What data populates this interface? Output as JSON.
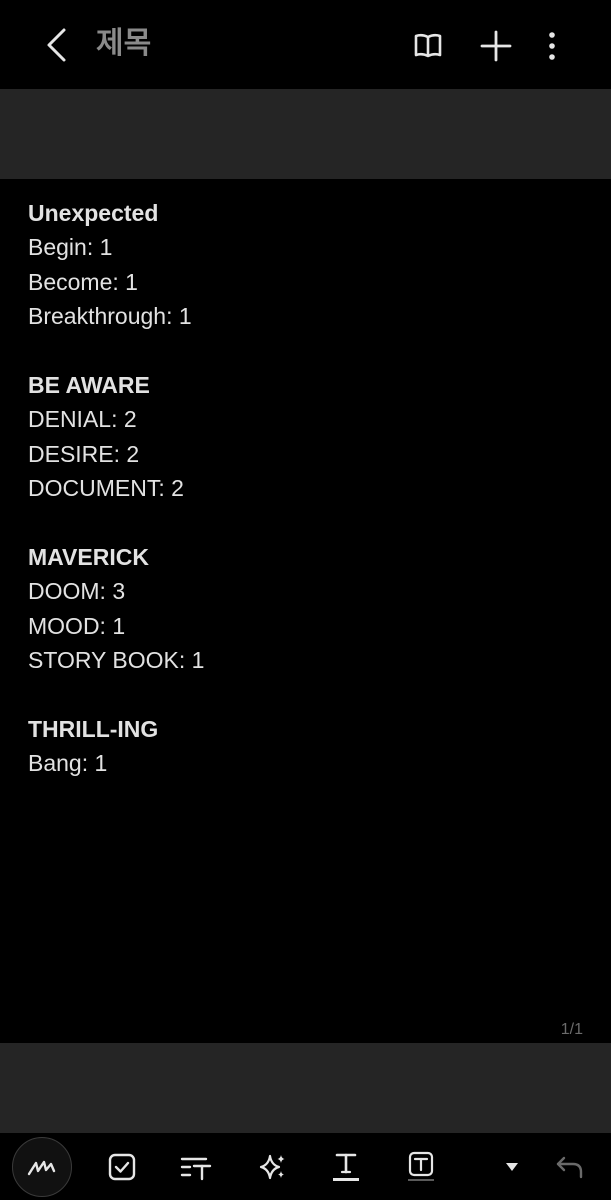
{
  "appbar": {
    "title": "제목"
  },
  "note": {
    "lines": [
      {
        "text": "Unexpected",
        "heading": true
      },
      {
        "text": "Begin: 1",
        "heading": false
      },
      {
        "text": "Become: 1",
        "heading": false
      },
      {
        "text": "Breakthrough: 1",
        "heading": false
      },
      {
        "text": "",
        "heading": false
      },
      {
        "text": "BE AWARE",
        "heading": true
      },
      {
        "text": "DENIAL: 2",
        "heading": false
      },
      {
        "text": "DESIRE: 2",
        "heading": false
      },
      {
        "text": "DOCUMENT: 2",
        "heading": false
      },
      {
        "text": "",
        "heading": false
      },
      {
        "text": "MAVERICK",
        "heading": true
      },
      {
        "text": "DOOM: 3",
        "heading": false
      },
      {
        "text": "MOOD: 1",
        "heading": false
      },
      {
        "text": "STORY BOOK: 1",
        "heading": false
      },
      {
        "text": "",
        "heading": false
      },
      {
        "text": "THRILL-ING",
        "heading": true
      },
      {
        "text": "Bang: 1",
        "heading": false
      }
    ]
  },
  "page_indicator": "1/1",
  "colors": {
    "background": "#000000",
    "panel": "#252525",
    "text": "#e2e2e2",
    "title": "#8a8a8a",
    "icon": "#e6e6e6"
  },
  "icons": {
    "appbar": [
      "back-arrow-icon",
      "reading-mode-icon",
      "add-icon",
      "more-options-icon"
    ],
    "toolbar": [
      "pen-icon",
      "checkbox-icon",
      "text-style-icon",
      "ai-sparkle-icon",
      "text-underline-icon",
      "text-box-icon",
      "dropdown-arrow-icon",
      "undo-icon"
    ]
  }
}
